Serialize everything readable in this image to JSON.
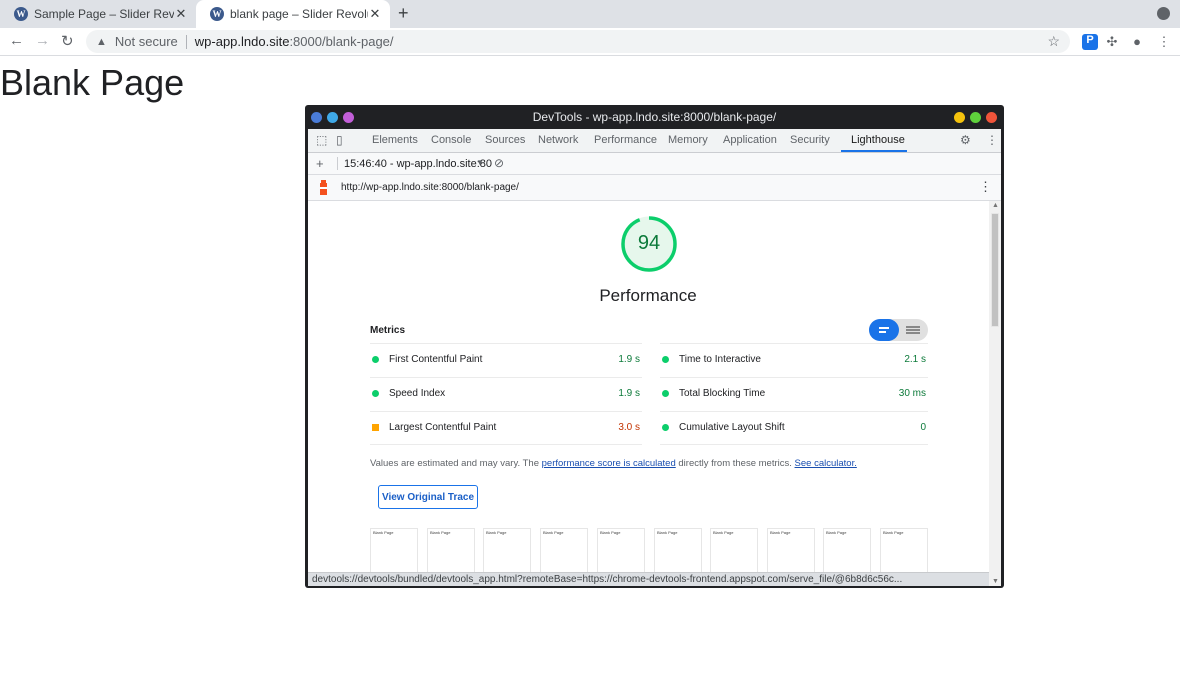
{
  "browser": {
    "tabs": [
      {
        "title": "Sample Page – Slider Revolution",
        "active": false
      },
      {
        "title": "blank page – Slider Revolution",
        "active": true
      }
    ],
    "new_tab": "+",
    "omnibox": {
      "security": "Not secure",
      "url_host": "wp-app.lndo.site",
      "url_rest": ":8000/blank-page/"
    },
    "extension_badge": "P"
  },
  "page": {
    "heading": "Blank Page"
  },
  "devtools": {
    "window_title": "DevTools - wp-app.lndo.site:8000/blank-page/",
    "tabs": [
      "Elements",
      "Console",
      "Sources",
      "Network",
      "Performance",
      "Memory",
      "Application",
      "Security",
      "Lighthouse"
    ],
    "active_tab": "Lighthouse",
    "report_selector": "15:46:40 - wp-app.lndo.site:80",
    "report_url": "http://wp-app.lndo.site:8000/blank-page/",
    "lighthouse": {
      "score": "94",
      "score_fraction": 0.94,
      "category": "Performance",
      "metrics_heading": "Metrics",
      "metrics_left": [
        {
          "label": "First Contentful Paint",
          "value": "1.9 s",
          "status": "pass"
        },
        {
          "label": "Speed Index",
          "value": "1.9 s",
          "status": "pass"
        },
        {
          "label": "Largest Contentful Paint",
          "value": "3.0 s",
          "status": "average"
        }
      ],
      "metrics_right": [
        {
          "label": "Time to Interactive",
          "value": "2.1 s",
          "status": "pass"
        },
        {
          "label": "Total Blocking Time",
          "value": "30 ms",
          "status": "pass"
        },
        {
          "label": "Cumulative Layout Shift",
          "value": "0",
          "status": "pass"
        }
      ],
      "note_prefix": "Values are estimated and may vary. The ",
      "note_link1": "performance score is calculated",
      "note_middle": " directly from these metrics. ",
      "note_link2": "See calculator.",
      "view_trace": "View Original Trace",
      "thumbnail_label": "Blank Page"
    },
    "status_url": "devtools://devtools/bundled/devtools_app.html?remoteBase=https://chrome-devtools-frontend.appspot.com/serve_file/@6b8d6c56c..."
  },
  "colors": {
    "pass": "#0cce6b",
    "average": "#ffa400",
    "accent": "#1a73e8"
  }
}
